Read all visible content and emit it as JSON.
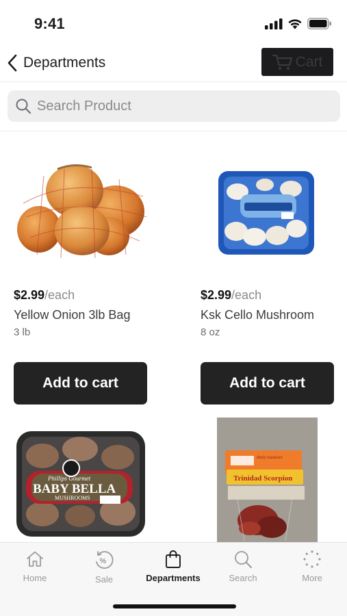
{
  "status_bar": {
    "time": "9:41"
  },
  "header": {
    "back_label": "Departments",
    "cart_label": "Cart"
  },
  "search": {
    "placeholder": "Search Product",
    "value": ""
  },
  "products": [
    {
      "price": "$2.99",
      "unit": "/each",
      "name": "Yellow Onion 3lb Bag",
      "size": "3 lb",
      "button": "Add to cart"
    },
    {
      "price": "$2.99",
      "unit": "/each",
      "name": "Ksk Cello Mushroom",
      "size": "8 oz",
      "button": "Add to cart"
    },
    {
      "image_text": {
        "brand": "Phillips Gourmet",
        "title": "BABY BELLA",
        "subtitle": "MUSHROOMS"
      }
    },
    {
      "image_text": {
        "brand": "Daily Gardener",
        "title": "Trinidad Scorpion"
      }
    }
  ],
  "tabs": [
    {
      "label": "Home",
      "icon": "home-icon",
      "active": false
    },
    {
      "label": "Sale",
      "icon": "sale-icon",
      "active": false
    },
    {
      "label": "Departments",
      "icon": "bag-icon",
      "active": true
    },
    {
      "label": "Search",
      "icon": "search-icon",
      "active": false
    },
    {
      "label": "More",
      "icon": "more-icon",
      "active": false
    }
  ],
  "colors": {
    "dark_button": "#232323",
    "search_bg": "#eeeeef",
    "muted_text": "#8a8a8e"
  }
}
